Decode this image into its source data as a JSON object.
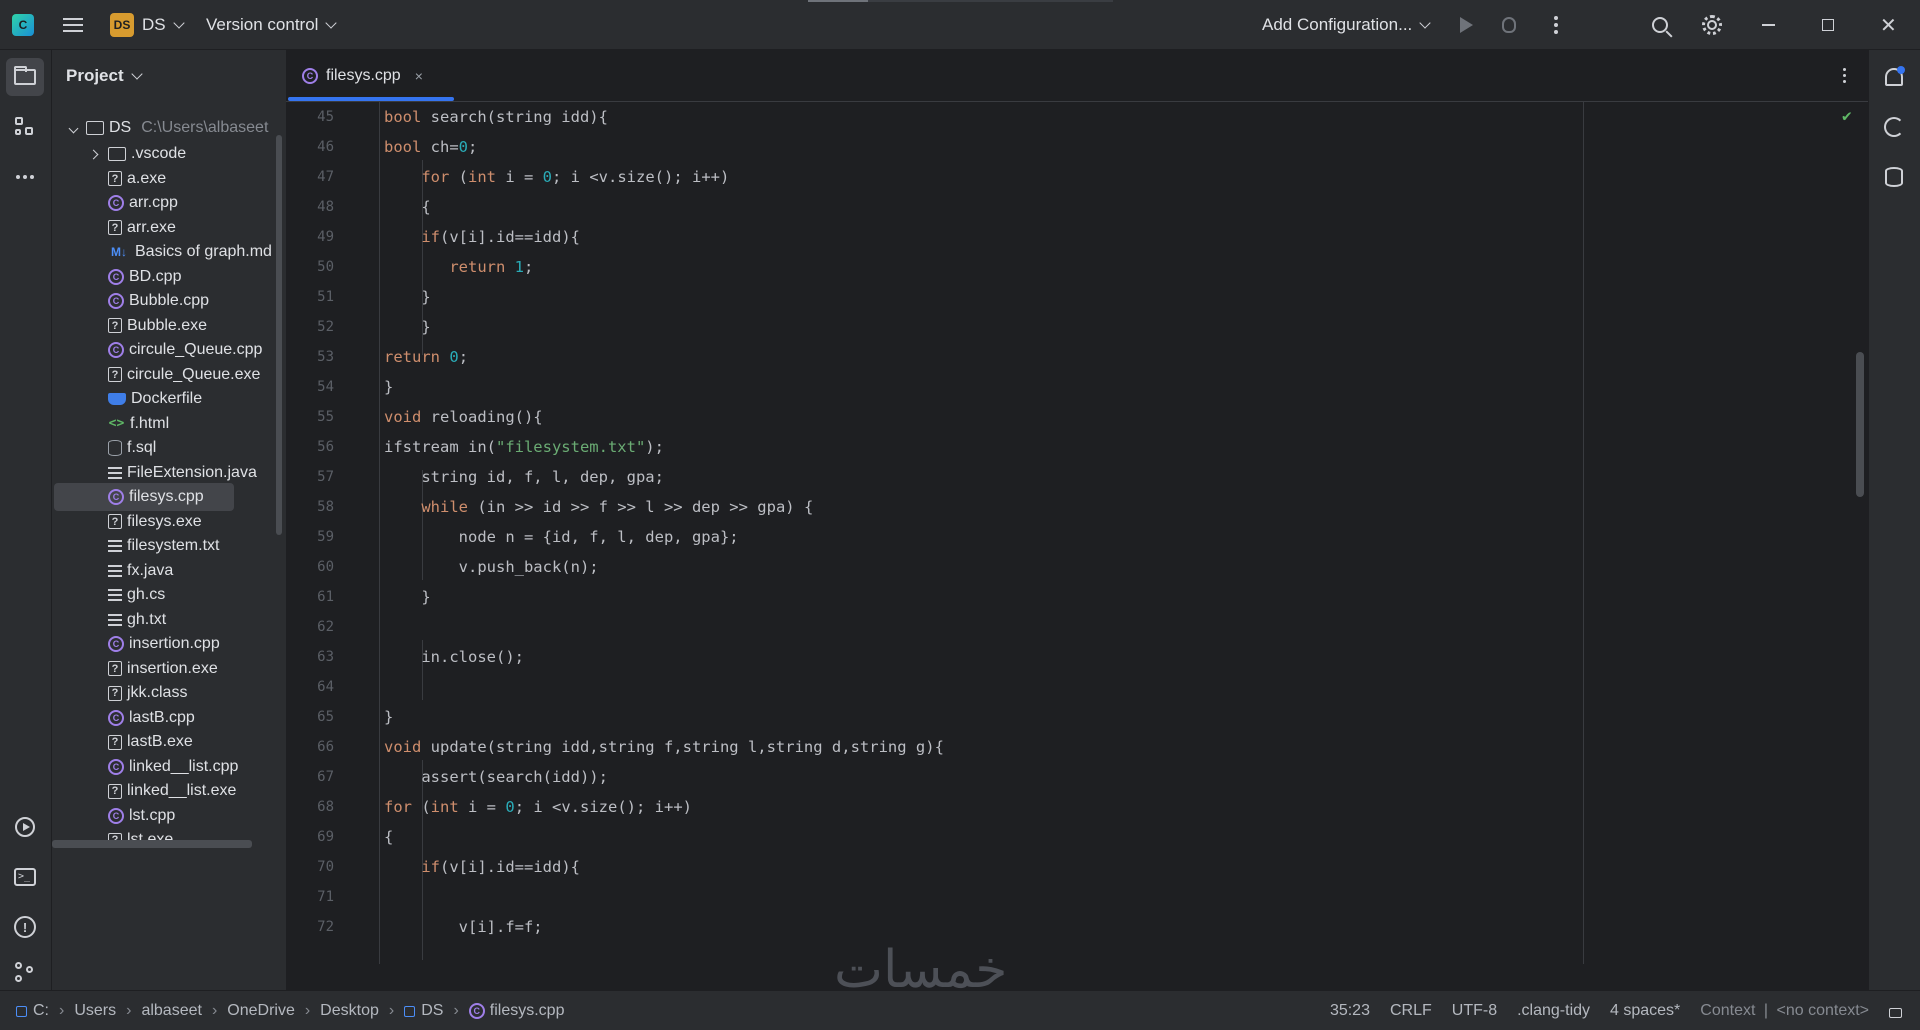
{
  "titlebar": {
    "project_badge": "DS",
    "project_name": "DS",
    "version_control": "Version control",
    "add_configuration": "Add Configuration..."
  },
  "project_panel": {
    "title": "Project",
    "root": {
      "name": "DS",
      "path": "C:\\Users\\albaseet"
    },
    "items": [
      {
        "name": ".vscode",
        "icon": "folder-icon"
      },
      {
        "name": "a.exe",
        "icon": "unknown-file-icon"
      },
      {
        "name": "arr.cpp",
        "icon": "cpp-file-icon"
      },
      {
        "name": "arr.exe",
        "icon": "unknown-file-icon"
      },
      {
        "name": "Basics of graph.md",
        "icon": "markdown-file-icon"
      },
      {
        "name": "BD.cpp",
        "icon": "cpp-file-icon"
      },
      {
        "name": "Bubble.cpp",
        "icon": "cpp-file-icon"
      },
      {
        "name": "Bubble.exe",
        "icon": "unknown-file-icon"
      },
      {
        "name": "circule_Queue.cpp",
        "icon": "cpp-file-icon"
      },
      {
        "name": "circule_Queue.exe",
        "icon": "unknown-file-icon"
      },
      {
        "name": "Dockerfile",
        "icon": "docker-file-icon"
      },
      {
        "name": "f.html",
        "icon": "html-file-icon"
      },
      {
        "name": "f.sql",
        "icon": "sql-file-icon"
      },
      {
        "name": "FileExtension.java",
        "icon": "text-file-icon"
      },
      {
        "name": "filesys.cpp",
        "icon": "cpp-file-icon"
      },
      {
        "name": "filesys.exe",
        "icon": "unknown-file-icon"
      },
      {
        "name": "filesystem.txt",
        "icon": "text-file-icon"
      },
      {
        "name": "fx.java",
        "icon": "text-file-icon"
      },
      {
        "name": "gh.cs",
        "icon": "text-file-icon"
      },
      {
        "name": "gh.txt",
        "icon": "text-file-icon"
      },
      {
        "name": "insertion.cpp",
        "icon": "cpp-file-icon"
      },
      {
        "name": "insertion.exe",
        "icon": "unknown-file-icon"
      },
      {
        "name": "jkk.class",
        "icon": "unknown-file-icon"
      },
      {
        "name": "lastB.cpp",
        "icon": "cpp-file-icon"
      },
      {
        "name": "lastB.exe",
        "icon": "unknown-file-icon"
      },
      {
        "name": "linked__list.cpp",
        "icon": "cpp-file-icon"
      },
      {
        "name": "linked__list.exe",
        "icon": "unknown-file-icon"
      },
      {
        "name": "lst.cpp",
        "icon": "cpp-file-icon"
      },
      {
        "name": "lst.exe",
        "icon": "unknown-file-icon"
      }
    ],
    "selected": "filesys.cpp"
  },
  "editor": {
    "tab": {
      "label": "filesys.cpp",
      "close": "×"
    },
    "lines": [
      {
        "num": "45",
        "text": "bool search(string idd){"
      },
      {
        "num": "46",
        "text": "bool ch=0;"
      },
      {
        "num": "47",
        "text": "    for (int i = 0; i <v.size(); i++)"
      },
      {
        "num": "48",
        "text": "    {"
      },
      {
        "num": "49",
        "text": "    if(v[i].id==idd){"
      },
      {
        "num": "50",
        "text": "       return 1;"
      },
      {
        "num": "51",
        "text": "    }"
      },
      {
        "num": "52",
        "text": "    }"
      },
      {
        "num": "53",
        "text": "return 0;"
      },
      {
        "num": "54",
        "text": "}"
      },
      {
        "num": "55",
        "text": "void reloading(){"
      },
      {
        "num": "56",
        "text": "ifstream in(\"filesystem.txt\");"
      },
      {
        "num": "57",
        "text": "    string id, f, l, dep, gpa;"
      },
      {
        "num": "58",
        "text": "    while (in >> id >> f >> l >> dep >> gpa) {"
      },
      {
        "num": "59",
        "text": "        node n = {id, f, l, dep, gpa};"
      },
      {
        "num": "60",
        "text": "        v.push_back(n);"
      },
      {
        "num": "61",
        "text": "    }"
      },
      {
        "num": "62",
        "text": ""
      },
      {
        "num": "63",
        "text": "    in.close();"
      },
      {
        "num": "64",
        "text": ""
      },
      {
        "num": "65",
        "text": "}"
      },
      {
        "num": "66",
        "text": "void update(string idd,string f,string l,string d,string g){"
      },
      {
        "num": "67",
        "text": "    assert(search(idd));"
      },
      {
        "num": "68",
        "text": "for (int i = 0; i <v.size(); i++)"
      },
      {
        "num": "69",
        "text": "{"
      },
      {
        "num": "70",
        "text": "    if(v[i].id==idd){"
      },
      {
        "num": "71",
        "text": ""
      },
      {
        "num": "72",
        "text": "        v[i].f=f;"
      }
    ],
    "watermark": "خمسات"
  },
  "statusbar": {
    "breadcrumbs": [
      "C:",
      "Users",
      "albaseet",
      "OneDrive",
      "Desktop",
      "DS",
      "filesys.cpp"
    ],
    "position": "35:23",
    "line_separator": "CRLF",
    "encoding": "UTF-8",
    "linter": ".clang-tidy",
    "indent": "4 spaces*",
    "context_label": "Context",
    "context_value": "<no context>"
  },
  "colors": {
    "accent": "#3574f0",
    "keyword": "#cf8e6d",
    "number": "#2aacb8",
    "string": "#6aab73",
    "cpp_icon": "#9f7fe8",
    "project_badge": "#d79b2f"
  }
}
